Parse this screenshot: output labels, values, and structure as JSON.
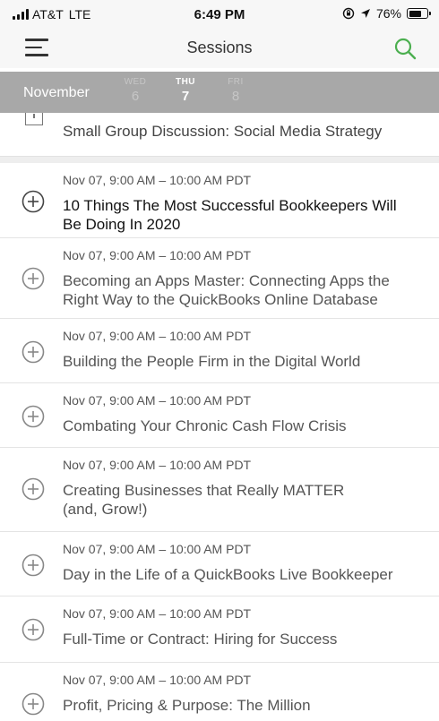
{
  "status_bar": {
    "carrier": "AT&T",
    "network": "LTE",
    "time": "6:49 PM",
    "battery": "76%",
    "battery_level": 0.76
  },
  "nav": {
    "title": "Sessions",
    "accent_color": "#4caf50"
  },
  "date_strip": {
    "month": "November",
    "days": [
      {
        "dow": "WED",
        "num": "6"
      },
      {
        "dow": "THU",
        "num": "7"
      },
      {
        "dow": "FRI",
        "num": "8"
      }
    ],
    "selected": "THU"
  },
  "partial_session": {
    "title": "Small Group Discussion: Social Media Strategy"
  },
  "sessions": [
    {
      "time": "Nov 07, 9:00 AM – 10:00 AM PDT",
      "title_lines": [
        "10 Things The Most Successful Bookkeepers Will",
        "Be Doing In 2020"
      ]
    },
    {
      "time": "Nov 07, 9:00 AM – 10:00 AM PDT",
      "title_lines": [
        "Becoming an Apps Master: Connecting Apps the",
        "Right Way to the QuickBooks Online Database"
      ]
    },
    {
      "time": "Nov 07, 9:00 AM – 10:00 AM PDT",
      "title_lines": [
        "Building the People Firm in the Digital World"
      ]
    },
    {
      "time": "Nov 07, 9:00 AM – 10:00 AM PDT",
      "title_lines": [
        "Combating Your Chronic Cash Flow Crisis"
      ]
    },
    {
      "time": "Nov 07, 9:00 AM – 10:00 AM PDT",
      "title_lines": [
        "Creating Businesses that Really MATTER",
        "(and, Grow!)"
      ]
    },
    {
      "time": "Nov 07, 9:00 AM – 10:00 AM PDT",
      "title_lines": [
        "Day in the Life of a QuickBooks Live Bookkeeper"
      ]
    },
    {
      "time": "Nov 07, 9:00 AM – 10:00 AM PDT",
      "title_lines": [
        "Full-Time or Contract: Hiring for Success"
      ]
    },
    {
      "time": "Nov 07, 9:00 AM – 10:00 AM PDT",
      "title_lines": [
        "Profit, Pricing & Purpose: The Million"
      ]
    }
  ]
}
